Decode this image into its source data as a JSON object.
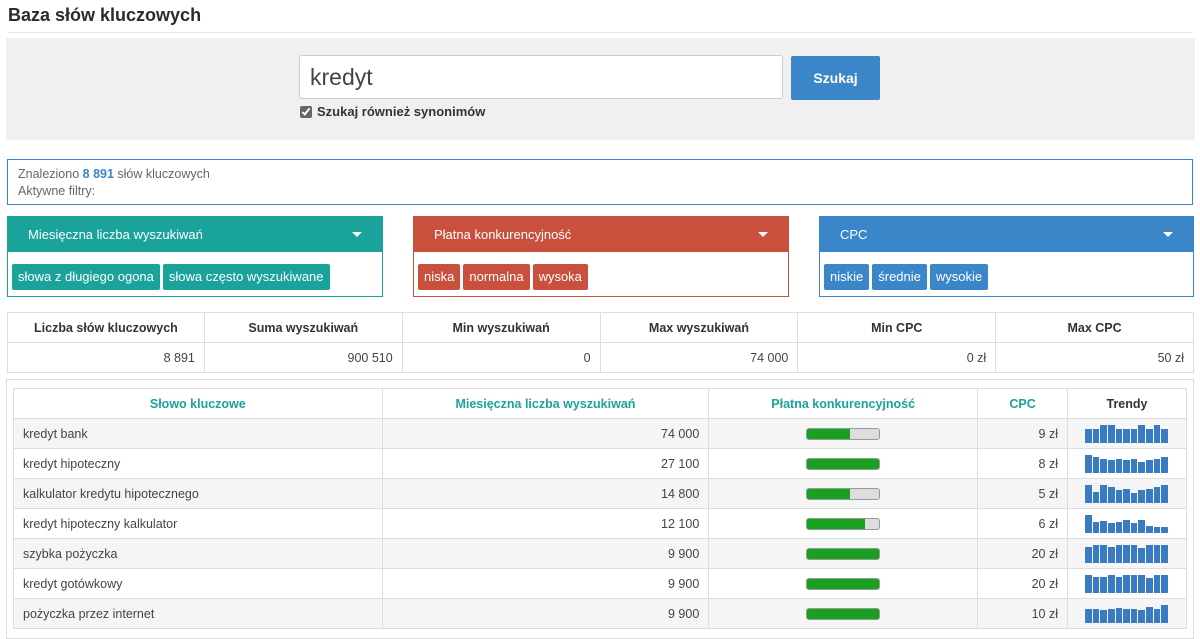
{
  "page": {
    "title": "Baza słów kluczowych"
  },
  "search": {
    "value": "kredyt",
    "button_label": "Szukaj",
    "synonyms_label": "Szukaj również synonimów",
    "synonyms_checked": true
  },
  "results": {
    "prefix": "Znaleziono",
    "count": "8 891",
    "suffix": "słów kluczowych",
    "filters_label": "Aktywne filtry:"
  },
  "filters": [
    {
      "title": "Miesięczna liczba wyszukiwań",
      "color": "#1aa39a",
      "tags": [
        "słowa z długiego ogona",
        "słowa często wyszukiwane"
      ]
    },
    {
      "title": "Płatna konkurencyjność",
      "color": "#c9503c",
      "tags": [
        "niska",
        "normalna",
        "wysoka"
      ]
    },
    {
      "title": "CPC",
      "color": "#3a86c8",
      "tags": [
        "niskie",
        "średnie",
        "wysokie"
      ]
    }
  ],
  "summary": {
    "headers": [
      "Liczba słów kluczowych",
      "Suma wyszukiwań",
      "Min wyszukiwań",
      "Max wyszukiwań",
      "Min CPC",
      "Max CPC"
    ],
    "values": [
      "8 891",
      "900 510",
      "0",
      "74 000",
      "0 zł",
      "50 zł"
    ]
  },
  "keywords": {
    "headers": [
      "Słowo kluczowe",
      "Miesięczna liczba wyszukiwań",
      "Płatna konkurencyjność",
      "CPC",
      "Trendy"
    ],
    "rows": [
      {
        "keyword": "kredyt bank",
        "searches": "74 000",
        "competition": 0.6,
        "cpc": "9 zł",
        "trend": [
          0.8,
          0.8,
          1.0,
          1.0,
          0.8,
          0.75,
          0.8,
          1.0,
          0.8,
          1.0,
          0.75
        ]
      },
      {
        "keyword": "kredyt hipoteczny",
        "searches": "27 100",
        "competition": 1.0,
        "cpc": "8 zł",
        "trend": [
          1.0,
          0.9,
          0.75,
          0.7,
          0.8,
          0.7,
          0.75,
          0.6,
          0.7,
          0.8,
          0.9
        ]
      },
      {
        "keyword": "kalkulator kredytu hipotecznego",
        "searches": "14 800",
        "competition": 0.6,
        "cpc": "5 zł",
        "trend": [
          1.0,
          0.6,
          1.0,
          0.9,
          0.7,
          0.8,
          0.55,
          0.7,
          0.8,
          0.9,
          1.0
        ]
      },
      {
        "keyword": "kredyt hipoteczny kalkulator",
        "searches": "12 100",
        "competition": 0.8,
        "cpc": "6 zł",
        "trend": [
          1.0,
          0.6,
          0.65,
          0.55,
          0.6,
          0.7,
          0.55,
          0.7,
          0.4,
          0.35,
          0.35
        ]
      },
      {
        "keyword": "szybka pożyczka",
        "searches": "9 900",
        "competition": 1.0,
        "cpc": "20 zł",
        "trend": [
          0.9,
          1.0,
          1.0,
          0.9,
          1.0,
          1.0,
          1.0,
          0.85,
          1.0,
          1.0,
          1.0
        ]
      },
      {
        "keyword": "kredyt gotówkowy",
        "searches": "9 900",
        "competition": 1.0,
        "cpc": "20 zł",
        "trend": [
          1.0,
          0.9,
          0.9,
          1.0,
          0.9,
          1.0,
          1.0,
          1.0,
          0.85,
          1.0,
          1.0
        ]
      },
      {
        "keyword": "pożyczka przez internet",
        "searches": "9 900",
        "competition": 1.0,
        "cpc": "10 zł",
        "trend": [
          0.75,
          0.8,
          0.7,
          0.8,
          0.85,
          0.75,
          0.8,
          0.7,
          0.9,
          0.8,
          1.0
        ]
      }
    ]
  }
}
